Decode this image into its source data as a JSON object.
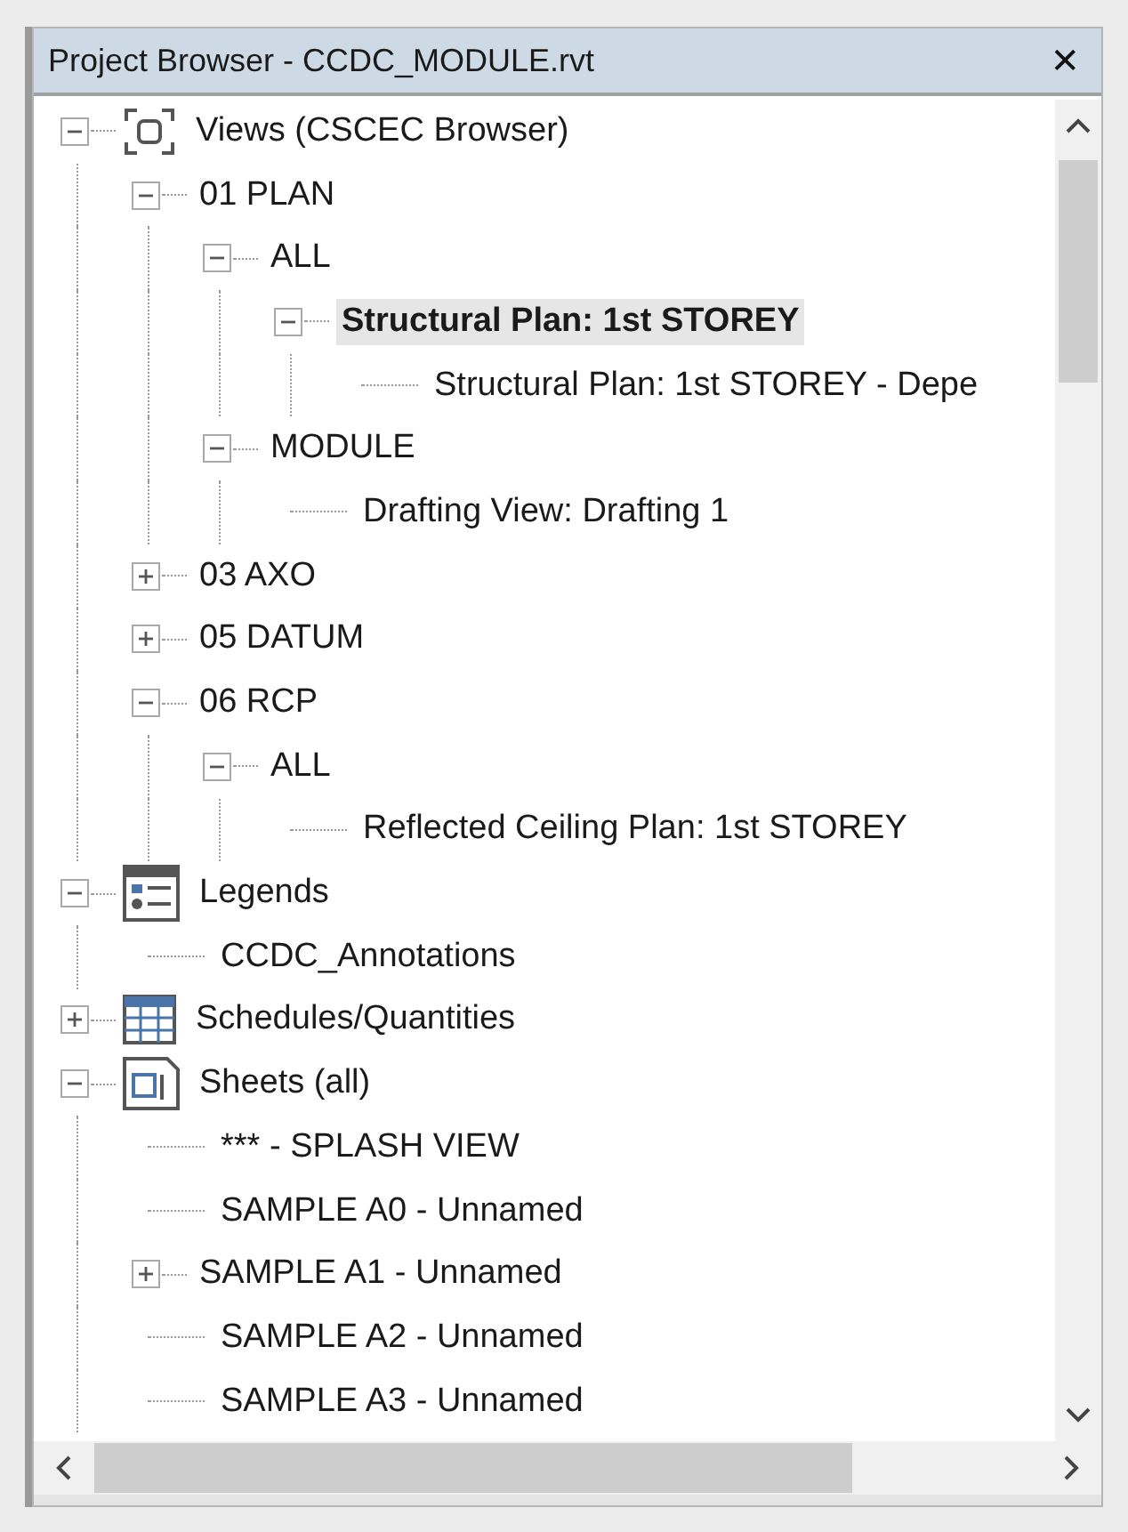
{
  "window": {
    "title": "Project Browser - CCDC_MODULE.rvt",
    "close": "✕"
  },
  "tree": [
    {
      "label": "Views (CSCEC Browser)",
      "kind": "views",
      "expanded": true,
      "selected": false,
      "children": [
        {
          "label": "01 PLAN",
          "expanded": true,
          "selected": false,
          "children": [
            {
              "label": "ALL",
              "expanded": true,
              "selected": false,
              "children": [
                {
                  "label": "Structural Plan: 1st STOREY",
                  "expanded": true,
                  "selected": true,
                  "children": [
                    {
                      "label": "Structural Plan: 1st STOREY - Depe",
                      "selected": false
                    }
                  ]
                }
              ]
            },
            {
              "label": "MODULE",
              "expanded": true,
              "selected": false,
              "children": [
                {
                  "label": "Drafting View: Drafting 1",
                  "selected": false
                }
              ]
            }
          ]
        },
        {
          "label": "03 AXO",
          "expanded": false,
          "selected": false
        },
        {
          "label": "05 DATUM",
          "expanded": false,
          "selected": false
        },
        {
          "label": "06 RCP",
          "expanded": true,
          "selected": false,
          "children": [
            {
              "label": "ALL",
              "expanded": true,
              "selected": false,
              "children": [
                {
                  "label": "Reflected Ceiling Plan: 1st STOREY",
                  "selected": false
                }
              ]
            }
          ]
        }
      ]
    },
    {
      "label": "Legends",
      "kind": "legends",
      "expanded": true,
      "selected": false,
      "children": [
        {
          "label": "CCDC_Annotations",
          "selected": false
        }
      ]
    },
    {
      "label": "Schedules/Quantities",
      "kind": "schedules",
      "expanded": false,
      "selected": false
    },
    {
      "label": "Sheets (all)",
      "kind": "sheets",
      "expanded": true,
      "selected": false,
      "children": [
        {
          "label": "*** - SPLASH VIEW",
          "selected": false
        },
        {
          "label": "SAMPLE A0 - Unnamed",
          "selected": false
        },
        {
          "label": "SAMPLE A1 - Unnamed",
          "expanded": false,
          "selected": false
        },
        {
          "label": "SAMPLE A2 - Unnamed",
          "selected": false
        },
        {
          "label": "SAMPLE A3 - Unnamed",
          "selected": false
        }
      ]
    }
  ]
}
